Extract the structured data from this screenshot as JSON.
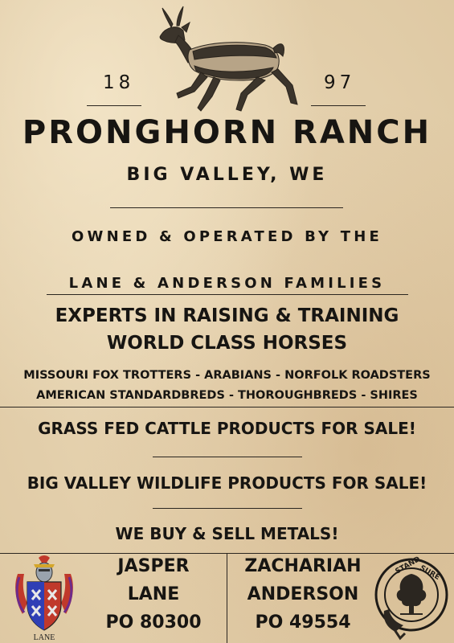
{
  "header": {
    "year_left": "18",
    "year_right": "97"
  },
  "title": "PRONGHORN RANCH",
  "location": "BIG VALLEY, WE",
  "owned_line": "OWNED & OPERATED BY THE",
  "families_line": "LANE & ANDERSON FAMILIES",
  "experts": {
    "line1": "EXPERTS IN RAISING & TRAINING",
    "line2": "WORLD CLASS HORSES"
  },
  "breeds": {
    "line1": "MISSOURI FOX TROTTERS - ARABIANS - NORFOLK ROADSTERS",
    "line2": "AMERICAN STANDARDBREDS - THOROUGHBREDS - SHIRES"
  },
  "sales": {
    "cattle": "GRASS FED CATTLE PRODUCTS FOR SALE!",
    "wildlife": "BIG VALLEY WILDLIFE PRODUCTS FOR SALE!",
    "metals": "WE BUY & SELL METALS!"
  },
  "contacts": [
    {
      "first": "JASPER",
      "last": "LANE",
      "po": "PO 80300"
    },
    {
      "first": "ZACHARIAH",
      "last": "ANDERSON",
      "po": "PO 49554"
    }
  ],
  "crests": {
    "left_label": "LANE",
    "right_motto_1": "STAND",
    "right_motto_2": "SURE"
  },
  "icons": {
    "animal": "pronghorn-antelope-icon",
    "left_crest": "lane-coat-of-arms-icon",
    "right_crest": "anderson-clan-badge-icon"
  }
}
